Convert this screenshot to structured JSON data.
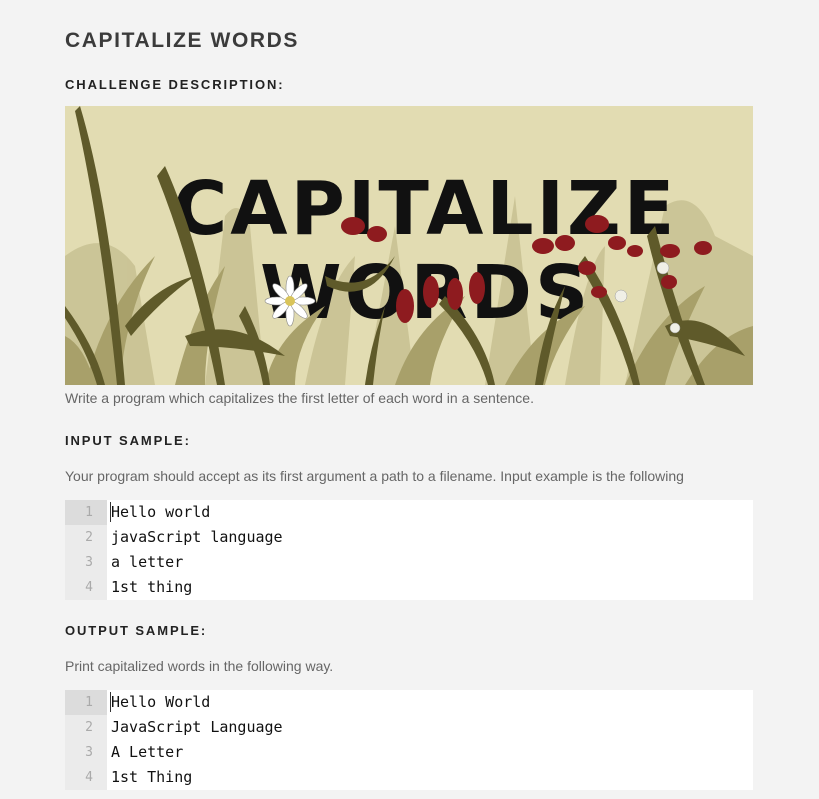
{
  "page_title": "CAPITALIZE WORDS",
  "challenge_heading": "CHALLENGE DESCRIPTION:",
  "banner": {
    "line1": "CAPITALIZE",
    "line2": "WORDS"
  },
  "description": "Write a program which capitalizes the first letter of each word in a sentence.",
  "input_heading": "INPUT SAMPLE:",
  "input_text": "Your program should accept as its first argument a path to a filename. Input example is the following",
  "input_code": [
    {
      "num": "1",
      "text": "Hello world"
    },
    {
      "num": "2",
      "text": "javaScript language"
    },
    {
      "num": "3",
      "text": "a letter"
    },
    {
      "num": "4",
      "text": "1st thing"
    }
  ],
  "output_heading": "OUTPUT SAMPLE:",
  "output_text": "Print capitalized words in the following way.",
  "output_code": [
    {
      "num": "1",
      "text": "Hello World"
    },
    {
      "num": "2",
      "text": "JavaScript Language"
    },
    {
      "num": "3",
      "text": "A Letter"
    },
    {
      "num": "4",
      "text": "1st Thing"
    }
  ],
  "colors": {
    "background": "#f3f3f3",
    "banner_bg": "#e2dcb2",
    "flower_red": "#8e1b1f",
    "grass_dark": "#5f5a2a",
    "grass_light": "#a8a06a"
  }
}
